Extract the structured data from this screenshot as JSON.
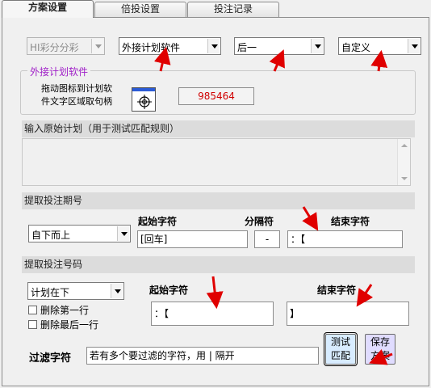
{
  "tabs": [
    {
      "label": "方案设置"
    },
    {
      "label": "倍投设置"
    },
    {
      "label": "投注记录"
    }
  ],
  "top_selects": {
    "lottery": "HI彩分分彩",
    "source": "外接计划软件",
    "position": "后一",
    "mode": "自定义"
  },
  "external": {
    "group_title": "外接计划软件",
    "instruction": "拖动图标到计划软\n件文字区域取句柄",
    "handle_value": "985464"
  },
  "raw_plan": {
    "header": "输入原始计划（用于测试匹配规则）",
    "text": ""
  },
  "period": {
    "header": "提取投注期号",
    "direction": "自下而上",
    "start_label": "起始字符",
    "separator_label": "分隔符",
    "end_label": "结束字符",
    "start_value": "[回车]",
    "separator_value": "-",
    "end_value": "：【"
  },
  "numbers": {
    "header": "提取投注号码",
    "plan_position": "计划在下",
    "delete_first": "删除第一行",
    "delete_last": "删除最后一行",
    "start_label": "起始字符",
    "end_label": "结束字符",
    "start_value": "：【",
    "end_value": "】"
  },
  "filter": {
    "label": "过滤字符",
    "value": "若有多个要过滤的字符，用 | 隔开"
  },
  "buttons": {
    "test": "测试\n匹配",
    "save": "保存\n方案"
  },
  "colors": {
    "handle_text": "#d00000",
    "group_title": "#a020c8",
    "arrows": "#e00000"
  }
}
